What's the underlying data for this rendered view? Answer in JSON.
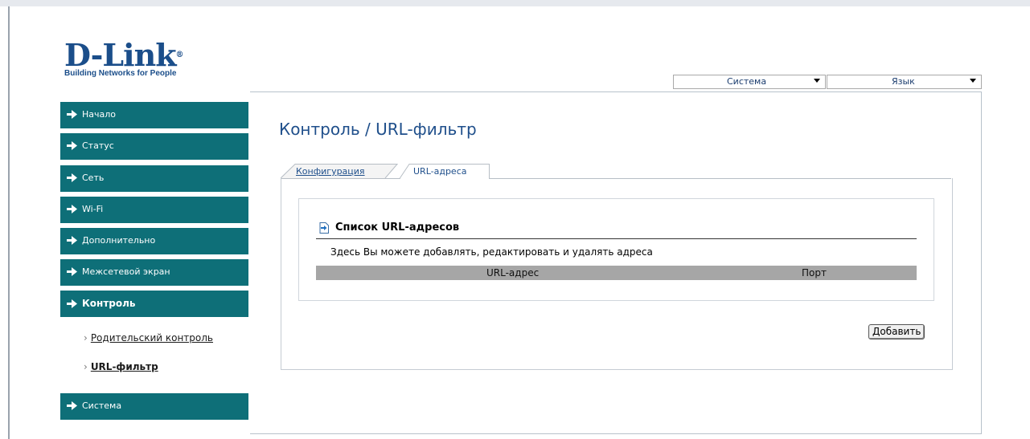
{
  "logo": {
    "brand": "D-Link",
    "tagline": "Building Networks for People"
  },
  "top_selects": [
    {
      "label": "Система"
    },
    {
      "label": "Язык"
    }
  ],
  "sidebar": {
    "items": [
      {
        "label": "Начало"
      },
      {
        "label": "Статус"
      },
      {
        "label": "Сеть"
      },
      {
        "label": "Wi-Fi"
      },
      {
        "label": "Дополнительно"
      },
      {
        "label": "Межсетевой экран"
      },
      {
        "label": "Контроль"
      },
      {
        "label": "Система"
      }
    ],
    "submenu": [
      {
        "label": "Родительский контроль"
      },
      {
        "label": "URL-фильтр"
      }
    ]
  },
  "main": {
    "title": "Контроль / URL-фильтр",
    "tabs": [
      {
        "label": "Конфигурация"
      },
      {
        "label": "URL-адреса"
      }
    ],
    "section_title": "Список URL-адресов",
    "description": "Здесь Вы можете добавлять, редактировать и удалять адреса",
    "table": {
      "columns": [
        "URL-адрес",
        "Порт"
      ],
      "rows": []
    },
    "add_button": "Добавить"
  },
  "colors": {
    "menu_bg": "#0e6f78",
    "title": "#1f4f8b",
    "brand": "#1b4e8a",
    "table_header": "#a6a6a6"
  }
}
